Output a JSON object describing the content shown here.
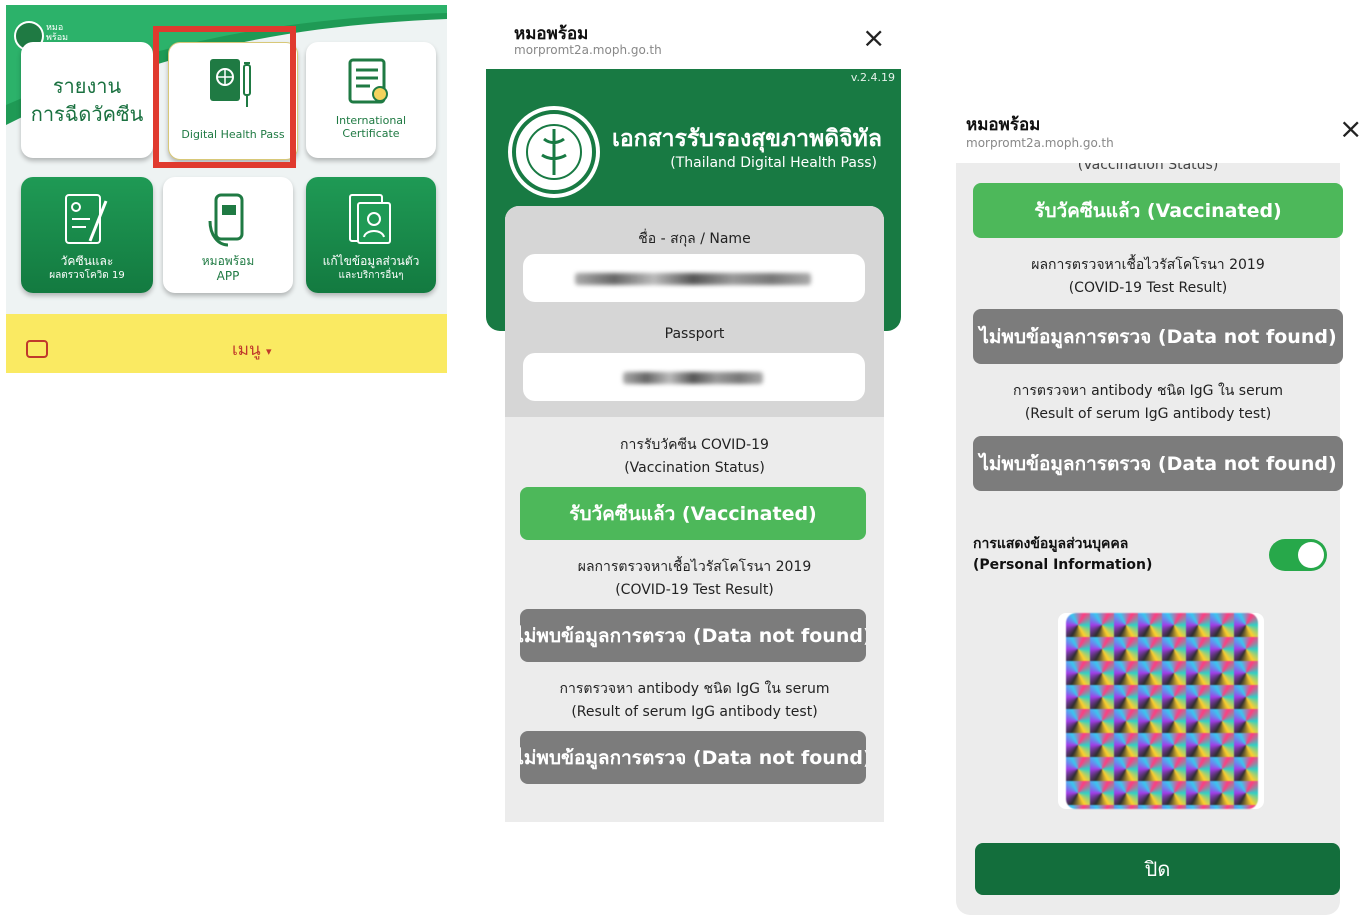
{
  "home": {
    "logo_text_1": "หมอ",
    "logo_text_2": "พร้อม",
    "tiles": [
      {
        "line1": "รายงาน",
        "line2": "การฉีดวัคซีน"
      },
      {
        "line1": "Digital Health Pass"
      },
      {
        "line1": "International Certificate"
      },
      {
        "line1": "วัคซีนและ",
        "line2": "ผลตรวจโควิด 19"
      },
      {
        "line1": "หมอพร้อม",
        "line2": "APP"
      },
      {
        "line1": "แก้ไขข้อมูลส่วนตัว",
        "line2": "และบริการอื่นๆ"
      }
    ],
    "menu_label": "เมนู",
    "menu_caret": "▾",
    "highlight_color": "#e03a2e"
  },
  "pass": {
    "app_title": "หมอพร้อม",
    "app_url": "morpromt2a.moph.go.th",
    "close_icon": "×",
    "version": "v.2.4.19",
    "title": "เอกสารรับรองสุขภาพดิจิทัล",
    "subtitle": "(Thailand Digital Health Pass)",
    "name_label": "ชื่อ - สกุล / Name",
    "passport_label": "Passport",
    "vaccination_label_1": "การรับวัคซีน COVID-19",
    "vaccination_label_2": "(Vaccination Status)",
    "vaccinated_button": "รับวัคซีนแล้ว (Vaccinated)",
    "test_label_1": "ผลการตรวจหาเชื้อไวรัสโคโรนา 2019",
    "test_label_2": "(COVID-19 Test Result)",
    "not_found_button": "ไม่พบข้อมูลการตรวจ (Data not found)",
    "antibody_label_1": "การตรวจหา antibody ชนิด IgG ใน serum",
    "antibody_label_2": "(Result of serum IgG antibody test)",
    "not_found_button_2": "ไม่พบข้อมูลการตรวจ (Data not found)",
    "header_color": "#187a43",
    "vaccinated_color": "#4db85a",
    "not_found_color": "#7c7c7c"
  },
  "info": {
    "app_title": "หมอพร้อม",
    "app_url": "morpromt2a.moph.go.th",
    "close_icon": "×",
    "cut_off_label": "(Vaccination Status)",
    "vaccinated_button": "รับวัคซีนแล้ว (Vaccinated)",
    "test_label_1": "ผลการตรวจหาเชื้อไวรัสโคโรนา 2019",
    "test_label_2": "(COVID-19 Test Result)",
    "not_found_button": "ไม่พบข้อมูลการตรวจ (Data not found)",
    "antibody_label_1": "การตรวจหา antibody ชนิด IgG ใน serum",
    "antibody_label_2": "(Result of serum IgG antibody test)",
    "not_found_button_2": "ไม่พบข้อมูลการตรวจ (Data not found)",
    "personal_info_label_1": "การแสดงข้อมูลส่วนบุคคล",
    "personal_info_label_2": "(Personal Information)",
    "toggle_on": true,
    "close_button": "ปิด",
    "close_button_color": "#136e3c"
  }
}
